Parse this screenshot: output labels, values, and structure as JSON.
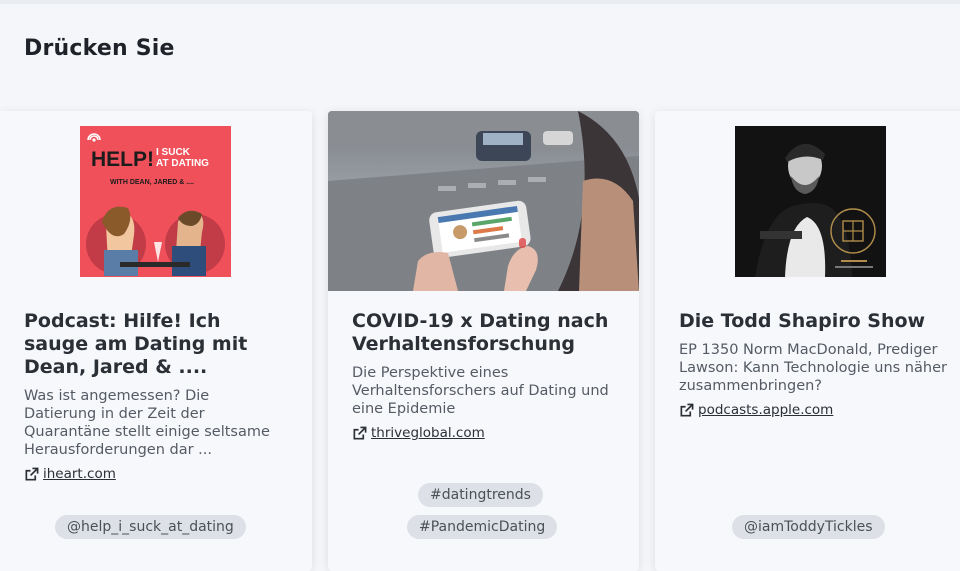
{
  "section": {
    "title": "Drücken Sie"
  },
  "cards": [
    {
      "thumbnail": {
        "title_line1": "HELP!",
        "title_line2a": "I SUCK",
        "title_line2b": "AT DATING",
        "subtitle": "WITH DEAN, JARED & ...."
      },
      "title": "Podcast: Hilfe! Ich sauge am Dating mit Dean, Jared & ....",
      "description": "Was ist angemessen? Die Datierung in der Zeit der Quarantäne stellt einige seltsame Herausforderungen dar ...",
      "source": "iheart.com",
      "tags": [
        "@help_i_suck_at_dating"
      ]
    },
    {
      "title": "COVID-19 x Dating nach Verhaltensforschung",
      "description": "Die Perspektive eines Verhaltensforschers auf Dating und eine Epidemie",
      "source": "thriveglobal.com",
      "tags": [
        "#datingtrends",
        "#PandemicDating"
      ]
    },
    {
      "title": "Die Todd Shapiro Show",
      "description": "EP 1350 Norm MacDonald, Prediger Lawson: Kann Technologie uns näher zusammenbringen?",
      "source": "podcasts.apple.com",
      "tags": [
        "@iamToddyTickles"
      ]
    }
  ],
  "colors": {
    "help_cover_bg": "#f0505a",
    "tag_bg": "#dde1e7",
    "page_bg": "#f4f6fa"
  },
  "icons": {
    "source_link": "external-link-icon"
  }
}
